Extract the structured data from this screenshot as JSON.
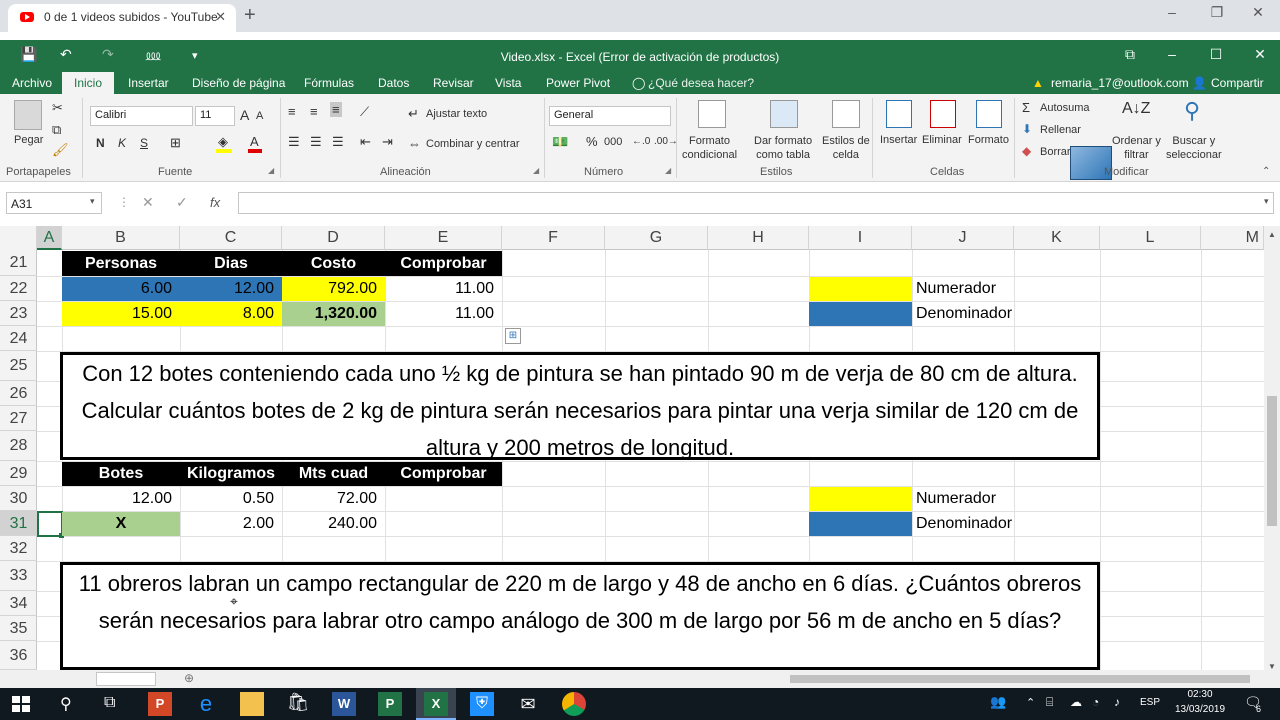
{
  "browser": {
    "tab_title": "0 de 1 videos subidos - YouTube",
    "new_tab": "+",
    "minimize": "–",
    "restore": "❐",
    "close": "✕"
  },
  "excel": {
    "title": "Video.xlsx - Excel (Error de activación de productos)",
    "undo": "↶",
    "redo": "↷",
    "account": "remaria_17@outlook.com",
    "share": "Compartir",
    "tabs": [
      "Archivo",
      "Inicio",
      "Insertar",
      "Diseño de página",
      "Fórmulas",
      "Datos",
      "Revisar",
      "Vista",
      "Power Pivot"
    ],
    "tell_me": "¿Qué desea hacer?"
  },
  "ribbon": {
    "clipboard": {
      "paste": "Pegar",
      "label": "Portapapeles"
    },
    "font": {
      "name": "Calibri",
      "size": "11",
      "bold": "N",
      "italic": "K",
      "underline": "S",
      "grow": "A",
      "shrink": "A",
      "label": "Fuente"
    },
    "alignment": {
      "wrap": "Ajustar texto",
      "merge": "Combinar y centrar",
      "label": "Alineación"
    },
    "number": {
      "format": "General",
      "percent": "%",
      "thousands": "000",
      "label": "Número"
    },
    "styles": {
      "conditional": "Formato\ncondicional",
      "table": "Dar formato\ncomo tabla",
      "cell": "Estilos de\ncelda",
      "label": "Estilos"
    },
    "cells": {
      "insert": "Insertar",
      "delete": "Eliminar",
      "format": "Formato",
      "label": "Celdas"
    },
    "editing": {
      "autosum": "Autosuma",
      "fill": "Rellenar",
      "clear": "Borrar",
      "sort": "Ordenar y\nfiltrar",
      "find": "Buscar y\nseleccionar",
      "label": "Modificar"
    }
  },
  "formula_bar": {
    "name_box": "A31",
    "fx": "fx",
    "value": ""
  },
  "columns": [
    "A",
    "B",
    "C",
    "D",
    "E",
    "F",
    "G",
    "H",
    "I",
    "J",
    "K",
    "L",
    "M"
  ],
  "rows": [
    "21",
    "22",
    "23",
    "24",
    "25",
    "26",
    "27",
    "28",
    "29",
    "30",
    "31",
    "32",
    "33",
    "34",
    "35",
    "36"
  ],
  "table1": {
    "headers": [
      "Personas",
      "Dias",
      "Costo",
      "Comprobar"
    ],
    "row22": [
      "6.00",
      "12.00",
      "792.00",
      "11.00"
    ],
    "row23": [
      "15.00",
      "8.00",
      "1,320.00",
      "11.00"
    ]
  },
  "legend1": {
    "numerador": "Numerador",
    "denominador": "Denominador"
  },
  "problem1": "Con 12 botes conteniendo cada uno ½ kg de pintura se han pintado 90 m de verja de 80 cm de altura. Calcular cuántos botes de 2 kg de pintura serán necesarios para pintar una verja similar de 120 cm de altura y 200 metros de longitud.",
  "table2": {
    "headers": [
      "Botes",
      "Kilogramos",
      "Mts cuad",
      "Comprobar"
    ],
    "row30": [
      "12.00",
      "0.50",
      "72.00",
      ""
    ],
    "row31": [
      "X",
      "2.00",
      "240.00",
      ""
    ]
  },
  "legend2": {
    "numerador": "Numerador",
    "denominador": "Denominador"
  },
  "problem2": "11 obreros labran un campo rectangular de 220 m de largo y 48 de ancho en 6 días. ¿Cuántos obreros serán necesarios para labrar otro campo análogo de 300 m de largo por 56 m de ancho en 5 días?",
  "colors": {
    "excel_green": "#217346",
    "blue": "#2e75b6",
    "yellow": "#ffff00",
    "green_cell": "#a9d08e"
  },
  "taskbar": {
    "lang": "ESP",
    "time": "02:30",
    "date": "13/03/2019",
    "notif": "6"
  }
}
